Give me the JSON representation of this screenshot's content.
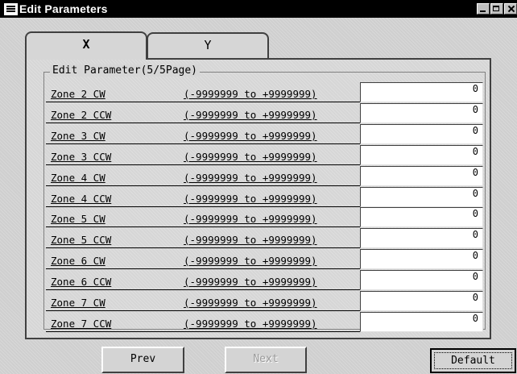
{
  "window": {
    "title": "Edit Parameters"
  },
  "tabs": [
    {
      "label": "X",
      "active": true
    },
    {
      "label": "Y",
      "active": false
    }
  ],
  "group": {
    "legend": "Edit Parameter(5/5Page)"
  },
  "parameters": [
    {
      "name": "Zone 2 CW",
      "range": "(-9999999 to +9999999)",
      "value": "0"
    },
    {
      "name": "Zone 2 CCW",
      "range": "(-9999999 to +9999999)",
      "value": "0"
    },
    {
      "name": "Zone 3 CW",
      "range": "(-9999999 to +9999999)",
      "value": "0"
    },
    {
      "name": "Zone 3 CCW",
      "range": "(-9999999 to +9999999)",
      "value": "0"
    },
    {
      "name": "Zone 4 CW",
      "range": "(-9999999 to +9999999)",
      "value": "0"
    },
    {
      "name": "Zone 4 CCW",
      "range": "(-9999999 to +9999999)",
      "value": "0"
    },
    {
      "name": "Zone 5 CW",
      "range": "(-9999999 to +9999999)",
      "value": "0"
    },
    {
      "name": "Zone 5 CCW",
      "range": "(-9999999 to +9999999)",
      "value": "0"
    },
    {
      "name": "Zone 6 CW",
      "range": "(-9999999 to +9999999)",
      "value": "0"
    },
    {
      "name": "Zone 6 CCW",
      "range": "(-9999999 to +9999999)",
      "value": "0"
    },
    {
      "name": "Zone 7 CW",
      "range": "(-9999999 to +9999999)",
      "value": "0"
    },
    {
      "name": "Zone 7 CCW",
      "range": "(-9999999 to +9999999)",
      "value": "0"
    }
  ],
  "buttons": {
    "prev": "Prev",
    "next": "Next",
    "default": "Default"
  }
}
